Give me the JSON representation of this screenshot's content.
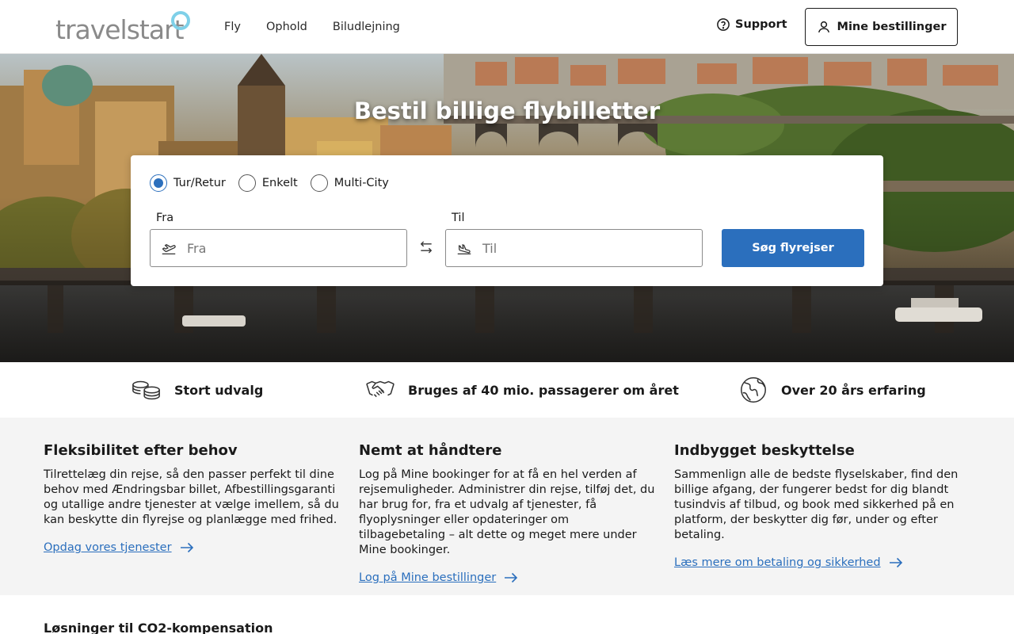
{
  "header": {
    "logo_text": "travelstart",
    "nav": [
      "Fly",
      "Ophold",
      "Biludlejning"
    ],
    "support_label": "Support",
    "bookings_label": "Mine bestillinger"
  },
  "hero": {
    "title": "Bestil billige flybilletter"
  },
  "search": {
    "trip_types": [
      {
        "label": "Tur/Retur",
        "checked": true
      },
      {
        "label": "Enkelt",
        "checked": false
      },
      {
        "label": "Multi-City",
        "checked": false
      }
    ],
    "from_label": "Fra",
    "from_placeholder": "Fra",
    "to_label": "Til",
    "to_placeholder": "Til",
    "submit_label": "Søg flyrejser"
  },
  "usp": [
    {
      "icon": "coins-icon",
      "label": "Stort udvalg"
    },
    {
      "icon": "handshake-icon",
      "label": "Bruges af 40 mio. passagerer om året"
    },
    {
      "icon": "globe-icon",
      "label": "Over 20 års erfaring"
    }
  ],
  "features": [
    {
      "title": "Fleksibilitet efter behov",
      "text": "Tilrettelæg din rejse, så den passer perfekt til dine behov med Ændringsbar billet, Afbestillingsgaranti og utallige andre tjenester at vælge imellem, så du kan beskytte din flyrejse og planlægge med frihed.",
      "link": "Opdag vores tjenester"
    },
    {
      "title": "Nemt at håndtere",
      "text": "Log på Mine bookinger for at få en hel verden af rejsemuligheder. Administrer din rejse, tilføj det, du har brug for, fra et udvalg af tjenester, få flyoplysninger eller opdateringer om tilbagebetaling – alt dette og meget mere under Mine bookinger.",
      "link": "Log på Mine bestillinger"
    },
    {
      "title": "Indbygget beskyttelse",
      "text": "Sammenlign alle de bedste flyselskaber, find den billige afgang, der fungerer bedst for dig blandt tusindvis af tilbud, og book med sikkerhed på en platform, der beskytter dig før, under og efter betaling.",
      "link": "Læs mere om betaling og sikkerhed"
    }
  ],
  "bottom_heading": "Løsninger til CO2-kompensation",
  "colors": {
    "accent": "#2b6fbd",
    "logo_ring": "#7fd0e8",
    "feature_bg": "#f4f4f4"
  }
}
